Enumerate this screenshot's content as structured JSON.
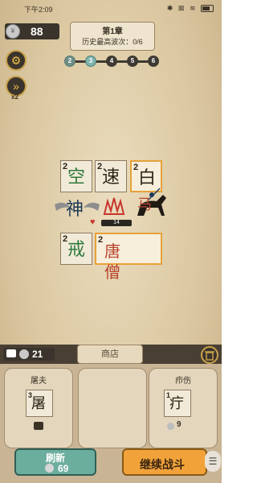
{
  "status": {
    "time": "下午2:09",
    "icons": "✱ ⊠ ≋"
  },
  "coins": {
    "value": "88"
  },
  "chapter": {
    "title": "第1章",
    "progress": "历史最高波次：0/6"
  },
  "speed": {
    "label": "x2"
  },
  "waves": [
    "2",
    "3",
    "4",
    "5",
    "6"
  ],
  "board": {
    "cards": [
      {
        "level": "2",
        "glyph": "空"
      },
      {
        "level": "2",
        "glyph": "速"
      },
      {
        "level": "2",
        "glyph": "白"
      },
      {
        "level": "",
        "glyph": "神"
      },
      {
        "level": "",
        "glyph": "马"
      },
      {
        "level": "2",
        "glyph": "戒"
      },
      {
        "level": "2",
        "glyph": "唐 僧"
      }
    ],
    "hp": "14"
  },
  "shop": {
    "tab": "商店",
    "video_cost": "21",
    "slots": [
      {
        "name": "屠夫",
        "level": "3",
        "glyph": "屠"
      },
      {
        "name": "",
        "level": "",
        "glyph": ""
      },
      {
        "name": "疖伤",
        "level": "1",
        "glyph": "疔",
        "price": "9"
      }
    ],
    "refresh_label": "刷新",
    "refresh_cost": "69",
    "continue_label": "继续战斗"
  }
}
